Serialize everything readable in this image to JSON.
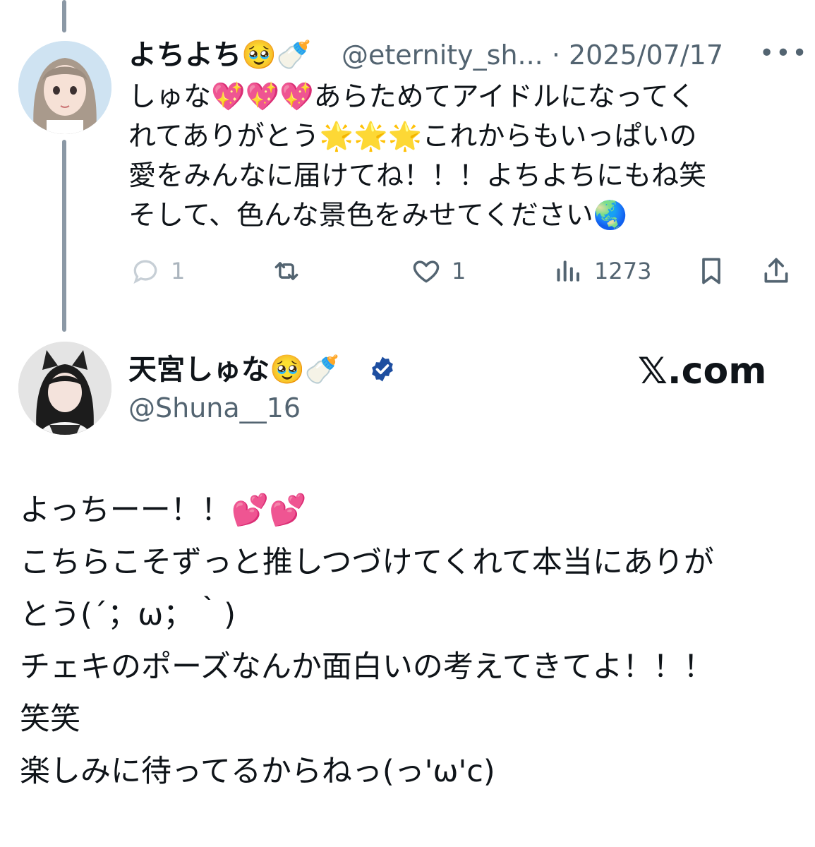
{
  "reply_tweet": {
    "display_name": "よちよち🥹🍼",
    "handle_and_date": "@eternity_sh... · 2025/07/17",
    "more_label": "•••",
    "body": "しゅな💖💖💖あらためてアイドルになってく\nれてありがとう🌟🌟🌟これからもいっぱいの\n愛をみんなに届けてね！！！よちよちにもね笑\nそして、色んな景色をみせてください🌏",
    "actions": {
      "reply_count": "1",
      "retweet_count": "",
      "like_count": "1",
      "views_count": "1273"
    }
  },
  "original_tweet": {
    "display_name": "天宮しゅな🥹🍼",
    "handle": "@Shuna__16",
    "verified": true,
    "site_logo": "𝕏.com",
    "body": "よっちーー！！💕💕\nこちらこそずっと推しつづけてくれて本当にありが\nとう(´；ω；｀)\nチェキのポーズなんか面白いの考えてきてよ！！！\n笑笑\n楽しみに待ってるからねっ(っ'ω'c)"
  },
  "icons": {
    "reply": "speech-bubble-icon",
    "retweet": "retweet-icon",
    "like": "heart-icon",
    "views": "bar-chart-icon",
    "bookmark": "bookmark-icon",
    "share": "share-icon",
    "badge": "verified-badge-icon"
  },
  "colors": {
    "text_primary": "#0f1419",
    "text_secondary": "#536471",
    "thread_line": "#8b98a5",
    "verified_badge": "#1d4ea0"
  }
}
